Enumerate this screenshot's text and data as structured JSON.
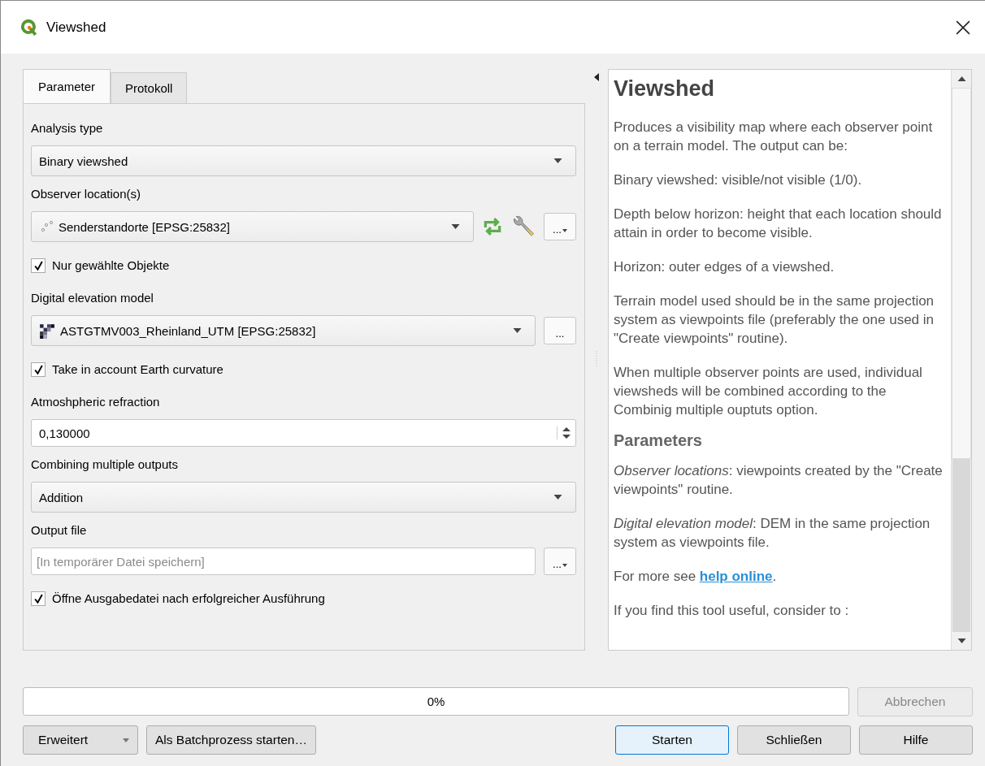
{
  "window": {
    "title": "Viewshed"
  },
  "tabs": [
    {
      "label": "Parameter",
      "selected": true
    },
    {
      "label": "Protokoll",
      "selected": false
    }
  ],
  "parameters": [
    {
      "kind": "combo",
      "label": "Analysis type",
      "value": "Binary viewshed"
    },
    {
      "kind": "point_layer",
      "label": "Observer location(s)",
      "value": "Senderstandorte [EPSG:25832]",
      "extra_tools": true,
      "browse": "...",
      "browse_menu": true
    },
    {
      "kind": "checkbox",
      "label": "Nur gewählte Objekte",
      "checked": true
    },
    {
      "kind": "raster_layer",
      "label": "Digital elevation model",
      "value": "ASTGTMV003_Rheinland_UTM [EPSG:25832]",
      "extra_tools": false,
      "browse": "...",
      "browse_menu": false
    },
    {
      "kind": "checkbox",
      "label": "Take in account Earth curvature",
      "checked": true
    },
    {
      "kind": "spin",
      "label": "Atmoshpheric refraction",
      "value": "0,130000"
    },
    {
      "kind": "combo",
      "label": "Combining multiple outputs",
      "value": "Addition"
    },
    {
      "kind": "file",
      "label": "Output file",
      "placeholder": "[In temporärer Datei speichern]",
      "browse": "...",
      "browse_menu": true
    },
    {
      "kind": "checkbox",
      "label": "Öffne Ausgabedatei nach erfolgreicher Ausführung",
      "checked": true
    }
  ],
  "help": {
    "title": "Viewshed",
    "paragraphs": [
      "Produces a visibility map where each observer point on a terrain model. The output can be:",
      "Binary viewshed: visible/not visible (1/0).",
      "Depth below horizon: height that each location should attain in order to become visible.",
      "Horizon: outer edges of a viewshed.",
      "Terrain model used should be in the same projection system as viewpoints file (preferably the one used in \"Create viewpoints\" routine).",
      "When multiple observer points are used, individual viewsheds will be combined according to the Combinig multiple ouptuts option."
    ],
    "heading": "Parameters",
    "parameter_notes": [
      "*Observer locations*: viewpoints created by the \"Create viewpoints\" routine.",
      "*Digital elevation model*: DEM in the same projection system as viewpoints file."
    ],
    "more": {
      "before": "For more see ",
      "link": "help online",
      "after": "."
    },
    "last": "If you find this tool useful, consider to :"
  },
  "progress": {
    "level": 0,
    "text": "0%"
  },
  "cancel": {
    "label": "Abbrechen",
    "disabled": true
  },
  "left_buttons": [
    {
      "label": "Erweitert",
      "menu": true
    },
    {
      "label": "Als Batchprozess starten…",
      "menu": false
    }
  ],
  "right_buttons": [
    {
      "label": "Starten",
      "default": true
    },
    {
      "label": "Schließen",
      "default": false
    },
    {
      "label": "Hilfe",
      "default": false
    }
  ]
}
